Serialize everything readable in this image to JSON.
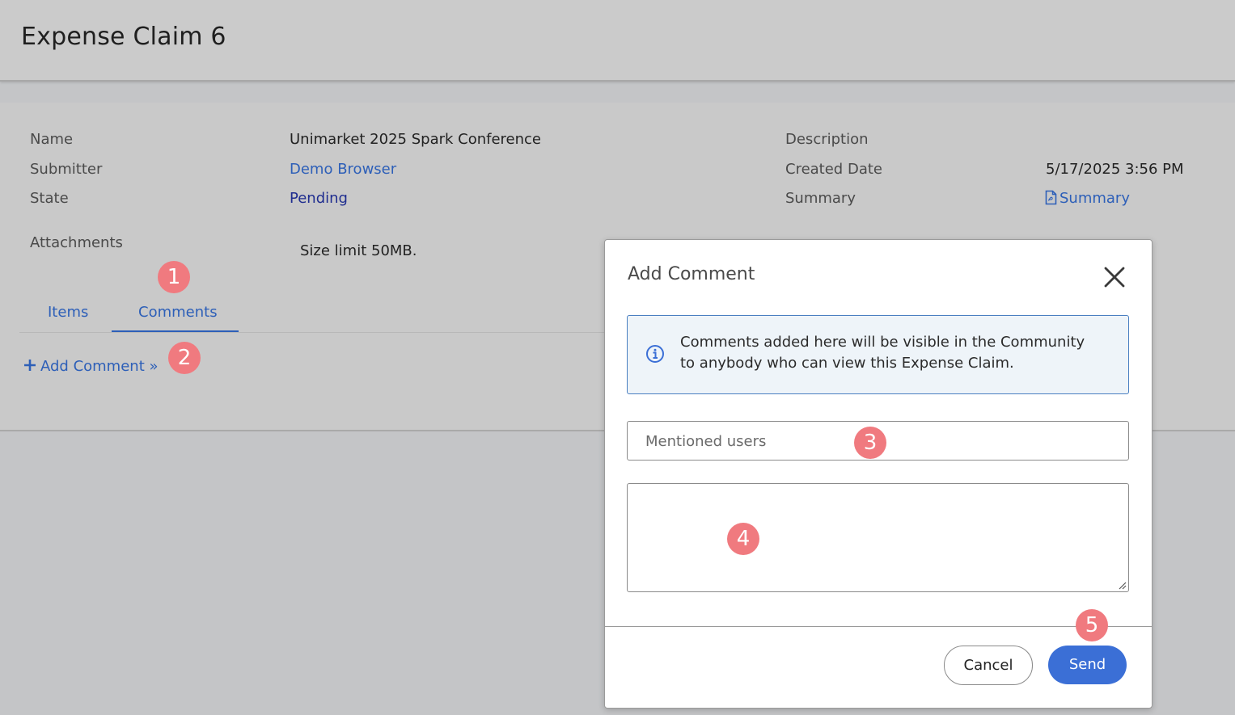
{
  "page": {
    "title": "Expense Claim 6"
  },
  "details": {
    "name_label": "Name",
    "name_value": "Unimarket 2025 Spark Conference",
    "submitter_label": "Submitter",
    "submitter_value": "Demo Browser",
    "state_label": "State",
    "state_value": "Pending",
    "description_label": "Description",
    "created_label": "Created Date",
    "created_value": "5/17/2025 3:56 PM",
    "summary_label": "Summary",
    "summary_link": "Summary",
    "attachments_label": "Attachments",
    "size_limit": "Size limit 50MB."
  },
  "tabs": [
    {
      "label": "Items"
    },
    {
      "label": "Comments",
      "active": true
    }
  ],
  "add_comment_link": "Add Comment »",
  "badges": [
    "1",
    "2",
    "3",
    "4",
    "5"
  ],
  "modal": {
    "title": "Add Comment",
    "info_text": "Comments added here will be visible in the Community to anybody who can view this Expense Claim.",
    "mentioned_placeholder": "Mentioned users",
    "comment_value": "",
    "cancel_label": "Cancel",
    "send_label": "Send"
  },
  "colors": {
    "link": "#2d5fb8",
    "state": "#1f2d8f",
    "badge": "#f07a7f",
    "primary_button": "#3b6fd6",
    "info_border": "#4a7fc1"
  },
  "icons": [
    "pdf-file-icon",
    "plus-icon",
    "close-icon",
    "info-icon",
    "resize-handle-icon"
  ]
}
